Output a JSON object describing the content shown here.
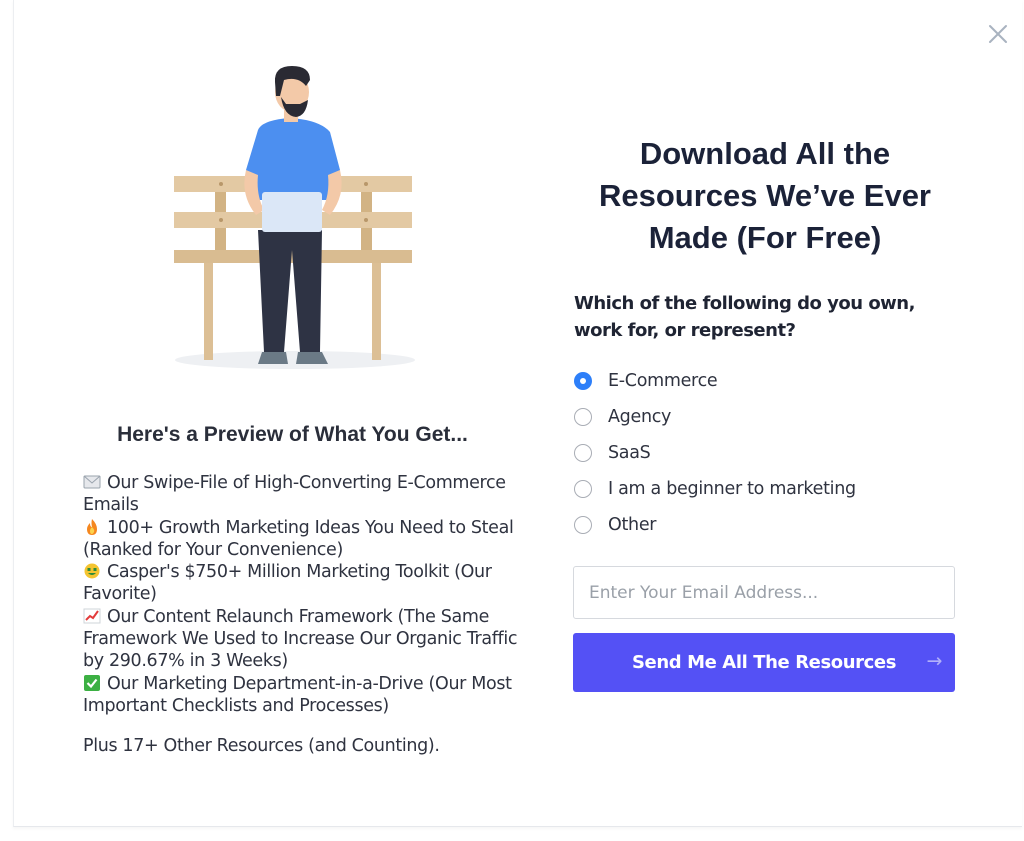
{
  "modal": {
    "headline_lines": [
      "Download All the",
      "Resources We’ve Ever",
      "Made (For Free)"
    ],
    "question": "Which of the following do you own, work for, or represent?",
    "options": [
      {
        "label": "E-Commerce",
        "checked": true
      },
      {
        "label": "Agency",
        "checked": false
      },
      {
        "label": "SaaS",
        "checked": false
      },
      {
        "label": "I am a beginner to marketing",
        "checked": false
      },
      {
        "label": "Other",
        "checked": false
      }
    ],
    "email": {
      "placeholder": "Enter Your Email Address...",
      "value": ""
    },
    "submit_label": "Send Me All The Resources",
    "submit_arrow": "→"
  },
  "preview": {
    "title": "Here's a Preview of What You Get...",
    "items": [
      {
        "icon": "envelope-icon",
        "text": "Our Swipe-File of High-Converting E-Commerce Emails"
      },
      {
        "icon": "fire-icon",
        "text": "100+ Growth Marketing Ideas You Need to Steal (Ranked for Your Convenience)"
      },
      {
        "icon": "money-face-icon",
        "text": "Casper's $750+ Million Marketing Toolkit (Our Favorite)"
      },
      {
        "icon": "chart-up-icon",
        "text": "Our Content Relaunch Framework (The Same Framework We Used to Increase Our Organic Traffic by 290.67% in 3 Weeks)"
      },
      {
        "icon": "checkmark-icon",
        "text": "Our Marketing Department-in-a-Drive (Our Most Important Checklists and Processes)"
      }
    ],
    "plus": "Plus 17+ Other Resources (and Counting)."
  },
  "colors": {
    "button": "#5451f5",
    "radio_selected": "#2d7ff9",
    "headline": "#1b2238"
  }
}
